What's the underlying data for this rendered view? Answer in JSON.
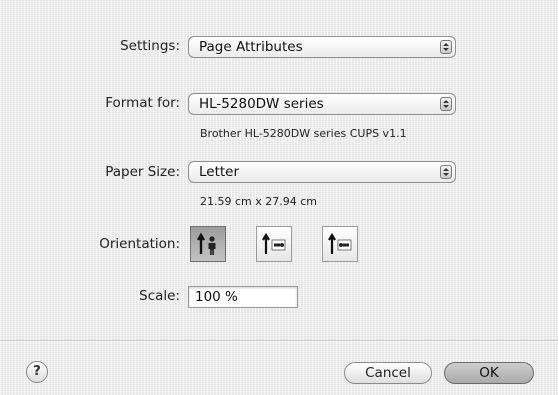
{
  "settings": {
    "label": "Settings:",
    "value": "Page Attributes"
  },
  "format_for": {
    "label": "Format for:",
    "value": "HL-5280DW series",
    "detail": "Brother HL-5280DW series CUPS v1.1"
  },
  "paper_size": {
    "label": "Paper Size:",
    "value": "Letter",
    "dimensions": "21.59 cm x 27.94 cm"
  },
  "orientation": {
    "label": "Orientation:",
    "selected": "portrait",
    "options": [
      "portrait",
      "landscape-left",
      "landscape-right"
    ]
  },
  "scale": {
    "label": "Scale:",
    "value": "100 %"
  },
  "buttons": {
    "help": "?",
    "cancel": "Cancel",
    "ok": "OK"
  }
}
